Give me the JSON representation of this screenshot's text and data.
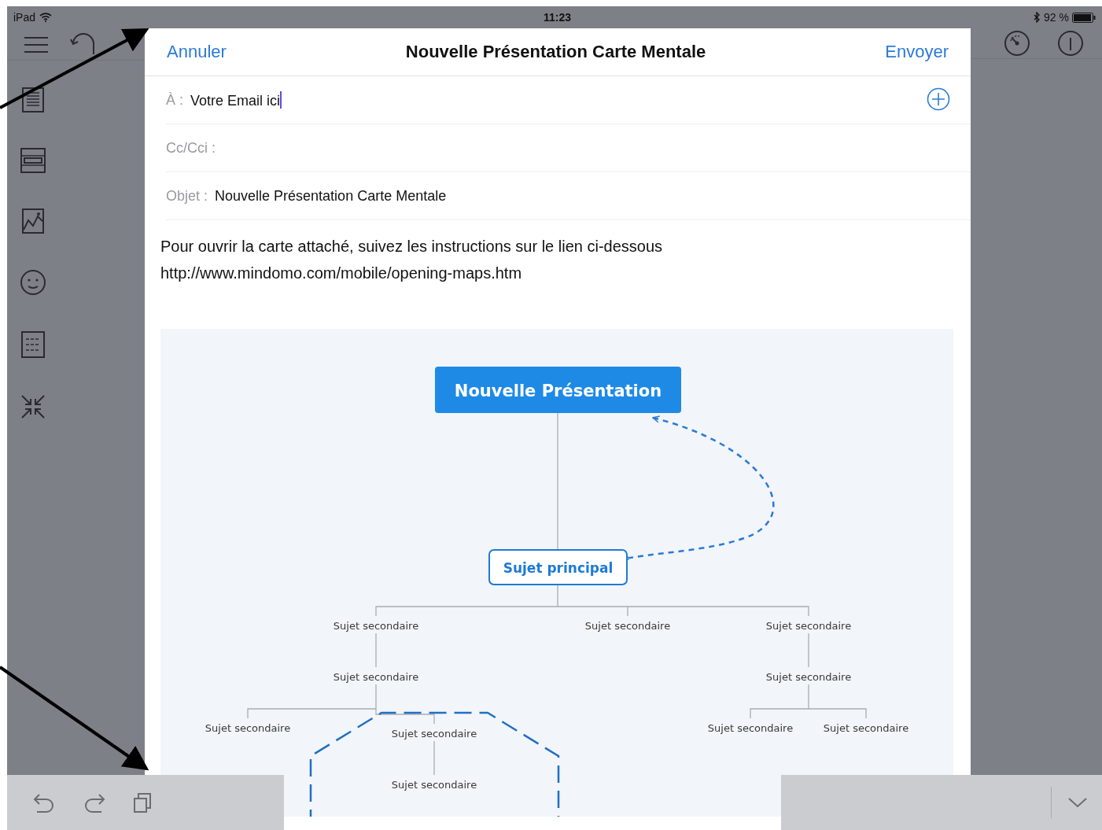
{
  "status_bar": {
    "device": "iPad",
    "time": "11:23",
    "battery": "92 %"
  },
  "compose": {
    "cancel": "Annuler",
    "title": "Nouvelle Présentation Carte Mentale",
    "send": "Envoyer",
    "fields": [
      {
        "label": "À :",
        "value": "Votre Email ici",
        "focused": true,
        "add_button": true
      },
      {
        "label": "Cc/Cci :"
      },
      {
        "label": "Objet :",
        "value": "Nouvelle Présentation Carte Mentale"
      }
    ],
    "body": [
      "Pour ouvrir la carte attaché, suivez les instructions sur le lien ci-dessous",
      "http://www.mindomo.com/mobile/opening-maps.htm"
    ],
    "mind_map": {
      "root": "Nouvelle Présentation",
      "main": "Sujet principal",
      "topics": [
        {
          "label": "Sujet secondaire",
          "children": [
            {
              "label": "Sujet secondaire",
              "children": [
                {
                  "label": "Sujet secondaire"
                },
                {
                  "label": "Sujet secondaire",
                  "boundary": true,
                  "children": [
                    {
                      "label": "Sujet secondaire"
                    }
                  ]
                }
              ]
            }
          ]
        },
        {
          "label": "Sujet secondaire"
        },
        {
          "label": "Sujet secondaire",
          "children": [
            {
              "label": "Sujet secondaire",
              "children": [
                {
                  "label": "Sujet secondaire"
                },
                {
                  "label": "Sujet secondaire"
                }
              ]
            }
          ]
        }
      ]
    }
  }
}
